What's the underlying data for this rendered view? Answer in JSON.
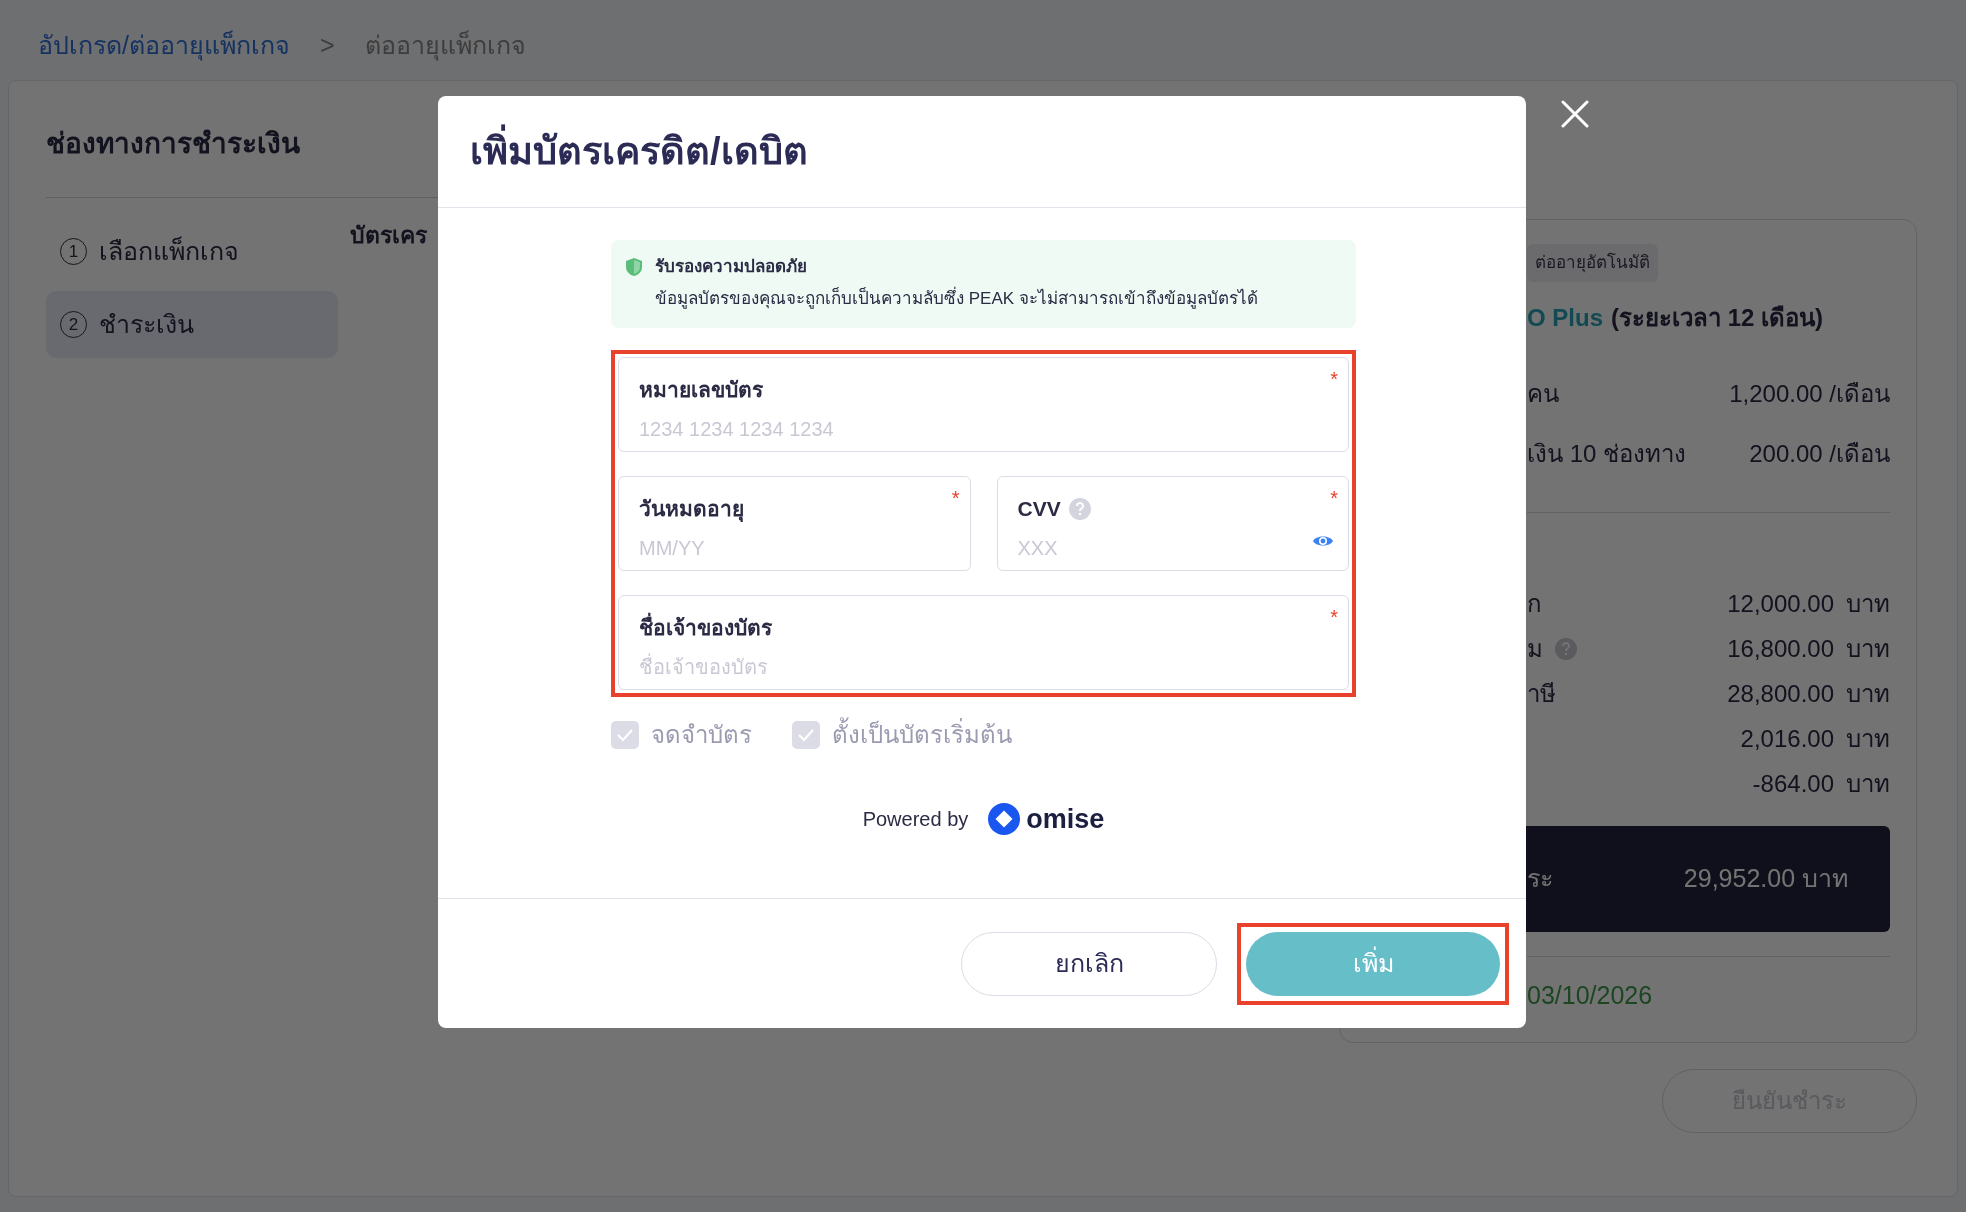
{
  "breadcrumb": {
    "link": "อัปเกรด/ต่ออายุแพ็กเกจ",
    "separator": ">",
    "current": "ต่ออายุแพ็กเกจ"
  },
  "page": {
    "title": "ช่องทางการชำระเงิน",
    "section_heading": "บัตรเคร",
    "steps": [
      {
        "number": "1",
        "label": "เลือกแพ็กเกจ",
        "selected": false
      },
      {
        "number": "2",
        "label": "ชำระเงิน",
        "selected": true
      }
    ]
  },
  "summary": {
    "tag": "ต่ออายุอัตโนมัติ",
    "plan_name": "O Plus",
    "plan_period": "(ระยะเวลา 12 เดือน)",
    "items": [
      {
        "label": "คน",
        "value": "1,200.00 /เดือน"
      },
      {
        "label": "เงิน 10 ช่องทาง",
        "value": "200.00 /เดือน"
      }
    ],
    "totals": [
      {
        "label": "ก",
        "amount": "12,000.00",
        "unit": "บาท",
        "help": false
      },
      {
        "label": "ม",
        "amount": "16,800.00",
        "unit": "บาท",
        "help": true
      },
      {
        "label": "าษี",
        "amount": "28,800.00",
        "unit": "บาท",
        "help": false
      },
      {
        "amount": "2,016.00",
        "unit": "บาท",
        "help": false
      },
      {
        "amount": "-864.00",
        "unit": "บาท",
        "help": false
      }
    ],
    "grand_total": {
      "label": "ระ",
      "amount": "29,952.00 บาท"
    },
    "date": "03/10/2026",
    "confirm_button": {
      "label": "ยืนยันชำระ",
      "disabled": true
    }
  },
  "modal": {
    "title": "เพิ่มบัตรเครดิต/เดบิต",
    "notice": {
      "title": "รับรองความปลอดภัย",
      "text": "ข้อมูลบัตรของคุณจะถูกเก็บเป็นความลับซึ่ง PEAK จะไม่สามารถเข้าถึงข้อมูลบัตรได้"
    },
    "form_highlighted": true,
    "fields": [
      {
        "label": "หมายเลขบัตร",
        "placeholder": "1234 1234 1234 1234",
        "required": true,
        "half": false,
        "help": false,
        "reveal": false
      },
      {
        "label": "วันหมดอายุ",
        "placeholder": "MM/YY",
        "required": true,
        "half": true,
        "help": false,
        "reveal": false
      },
      {
        "label": "CVV",
        "placeholder": "XXX",
        "required": true,
        "half": true,
        "help": true,
        "reveal": true
      },
      {
        "label": "ชื่อเจ้าของบัตร",
        "placeholder": "ชื่อเจ้าของบัตร",
        "required": true,
        "half": false,
        "help": false,
        "reveal": false
      }
    ],
    "required_mark": "*",
    "checkboxes": [
      {
        "label": "จดจำบัตร",
        "checked": true,
        "disabled": true
      },
      {
        "label": "ตั้งเป็นบัตรเริ่มต้น",
        "checked": true,
        "disabled": true
      }
    ],
    "powered_by": {
      "text": "Powered by",
      "brand": "omise"
    },
    "buttons": [
      {
        "kind": "secondary",
        "label": "ยกเลิก",
        "highlighted": false
      },
      {
        "kind": "primary",
        "label": "เพิ่ม",
        "highlighted": true
      }
    ]
  }
}
